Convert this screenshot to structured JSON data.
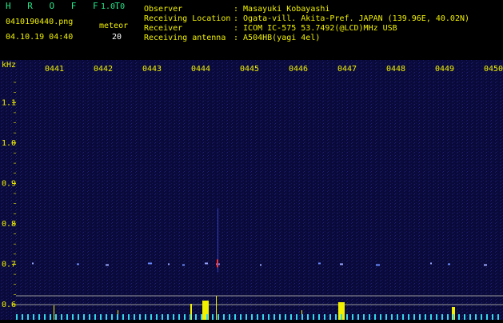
{
  "app": {
    "name": "H R O F F T",
    "version": "1.0.0"
  },
  "file": {
    "name": "0410190440.png",
    "datetime": "04.10.19 04:40"
  },
  "meteor": {
    "label": "meteor",
    "count": "20"
  },
  "info": {
    "observer_label": "Observer",
    "observer_value": ": Masayuki Kobayashi",
    "location_label": "Receiving Location",
    "location_value": ": Ogata-vill. Akita-Pref. JAPAN (139.96E, 40.02N)",
    "receiver_label": "Receiver",
    "receiver_value": ": ICOM IC-575 53.7492(@LCD)MHz USB",
    "antenna_label": "Receiving antenna",
    "antenna_value": ": A504HB(yagi 4el)"
  },
  "colors": {
    "accent": "#25e58a",
    "axis": "#f0f000",
    "text": "#ffffff",
    "background": "#0a0a3a"
  },
  "chart_data": {
    "type": "heatmap",
    "title": "",
    "ylabel": "kHz",
    "x_ticks": [
      "0441",
      "0442",
      "0443",
      "0444",
      "0445",
      "0446",
      "0447",
      "0448",
      "0449",
      "0450"
    ],
    "y_ticks": [
      "1.1",
      "1.0",
      "0.9",
      "0.8",
      "0.7",
      "0.6"
    ],
    "ylim": [
      0.6,
      1.15
    ],
    "grid": false
  }
}
